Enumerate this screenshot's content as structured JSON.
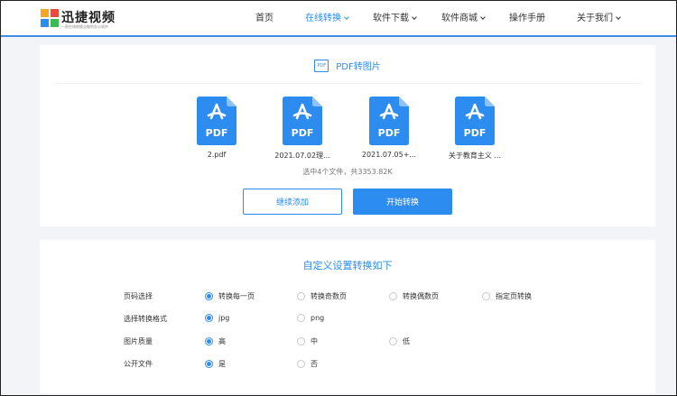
{
  "brand": {
    "name": "迅捷视频",
    "tagline": "一款在线转换全能的办公软件"
  },
  "nav": {
    "items": [
      {
        "label": "首页",
        "has_dropdown": false,
        "active": false
      },
      {
        "label": "在线转换",
        "has_dropdown": true,
        "active": true
      },
      {
        "label": "软件下载",
        "has_dropdown": true,
        "active": false
      },
      {
        "label": "软件商城",
        "has_dropdown": true,
        "active": false
      },
      {
        "label": "操作手册",
        "has_dropdown": false,
        "active": false
      },
      {
        "label": "关于我们",
        "has_dropdown": true,
        "active": false
      }
    ]
  },
  "converter": {
    "title": "PDF转图片",
    "title_icon_text": "PDF",
    "files": [
      {
        "icon_text": "PDF",
        "name": "2.pdf"
      },
      {
        "icon_text": "PDF",
        "name": "2021.07.02理..."
      },
      {
        "icon_text": "PDF",
        "name": "2021.07.05+..."
      },
      {
        "icon_text": "PDF",
        "name": "关于教育主义 ..."
      }
    ],
    "summary": "选中4个文件，共3353.82K",
    "add_button": "继续添加",
    "start_button": "开始转换"
  },
  "settings": {
    "title": "自定义设置转换如下",
    "rows": [
      {
        "label": "页码选择",
        "options": [
          "转换每一页",
          "转换奇数页",
          "转换偶数页",
          "指定页转换"
        ],
        "selected": 0
      },
      {
        "label": "选择转换格式",
        "options": [
          "jpg",
          "png"
        ],
        "selected": 0
      },
      {
        "label": "图片质量",
        "options": [
          "高",
          "中",
          "低"
        ],
        "selected": 0
      },
      {
        "label": "公开文件",
        "options": [
          "是",
          "否"
        ],
        "selected": 0
      }
    ]
  },
  "colors": {
    "accent": "#2d8cf0",
    "pdf_icon": "#2d8cf0",
    "background": "#f2f4f7"
  }
}
